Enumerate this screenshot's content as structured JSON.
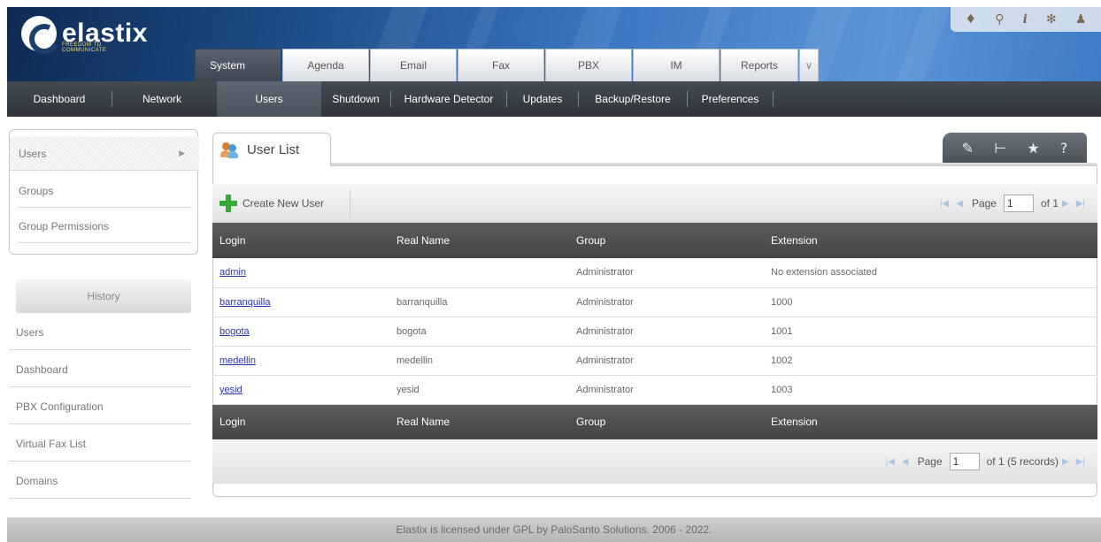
{
  "app": {
    "logo_text": "elastix",
    "logo_tagline": "FREEDOM TO COMMUNICATE"
  },
  "top_tabs": [
    {
      "label": "System"
    },
    {
      "label": "Agenda"
    },
    {
      "label": "Email"
    },
    {
      "label": "Fax"
    },
    {
      "label": "PBX"
    },
    {
      "label": "IM"
    },
    {
      "label": "Reports"
    },
    {
      "label": "∨"
    }
  ],
  "top_icons": [
    "drop-icon",
    "search-icon",
    "info-icon",
    "addon-icon",
    "user-icon"
  ],
  "sub_nav": [
    {
      "label": "Dashboard"
    },
    {
      "label": "Network"
    },
    {
      "label": "Users"
    },
    {
      "label": "Shutdown"
    },
    {
      "label": "Hardware Detector"
    },
    {
      "label": "Updates"
    },
    {
      "label": "Backup/Restore"
    },
    {
      "label": "Preferences"
    }
  ],
  "sidebar": {
    "items": [
      {
        "label": "Users"
      },
      {
        "label": "Groups"
      },
      {
        "label": "Group Permissions"
      }
    ],
    "history_label": "History",
    "history": [
      {
        "label": "Users"
      },
      {
        "label": "Dashboard"
      },
      {
        "label": "PBX Configuration"
      },
      {
        "label": "Virtual Fax List"
      },
      {
        "label": "Domains"
      }
    ]
  },
  "panel": {
    "title": "User List",
    "create_button": "Create New User",
    "pager_top": {
      "page_label": "Page",
      "page_value": "1",
      "of_label": "of 1"
    },
    "pager_bottom": {
      "page_label": "Page",
      "page_value": "1",
      "of_label": "of 1 (5 records)"
    }
  },
  "table": {
    "columns": [
      "Login",
      "Real Name",
      "Group",
      "Extension"
    ],
    "rows": [
      {
        "login": "admin",
        "real_name": "",
        "group": "Administrator",
        "extension": "No extension associated"
      },
      {
        "login": "barranquilla",
        "real_name": "barranquilla",
        "group": "Administrator",
        "extension": "1000"
      },
      {
        "login": "bogota",
        "real_name": "bogota",
        "group": "Administrator",
        "extension": "1001"
      },
      {
        "login": "medellin",
        "real_name": "medellin",
        "group": "Administrator",
        "extension": "1002"
      },
      {
        "login": "yesid",
        "real_name": "yesid",
        "group": "Administrator",
        "extension": "1003"
      }
    ]
  },
  "footer": {
    "text": "Elastix is licensed under GPL by PaloSanto Solutions. 2006 - 2022."
  }
}
